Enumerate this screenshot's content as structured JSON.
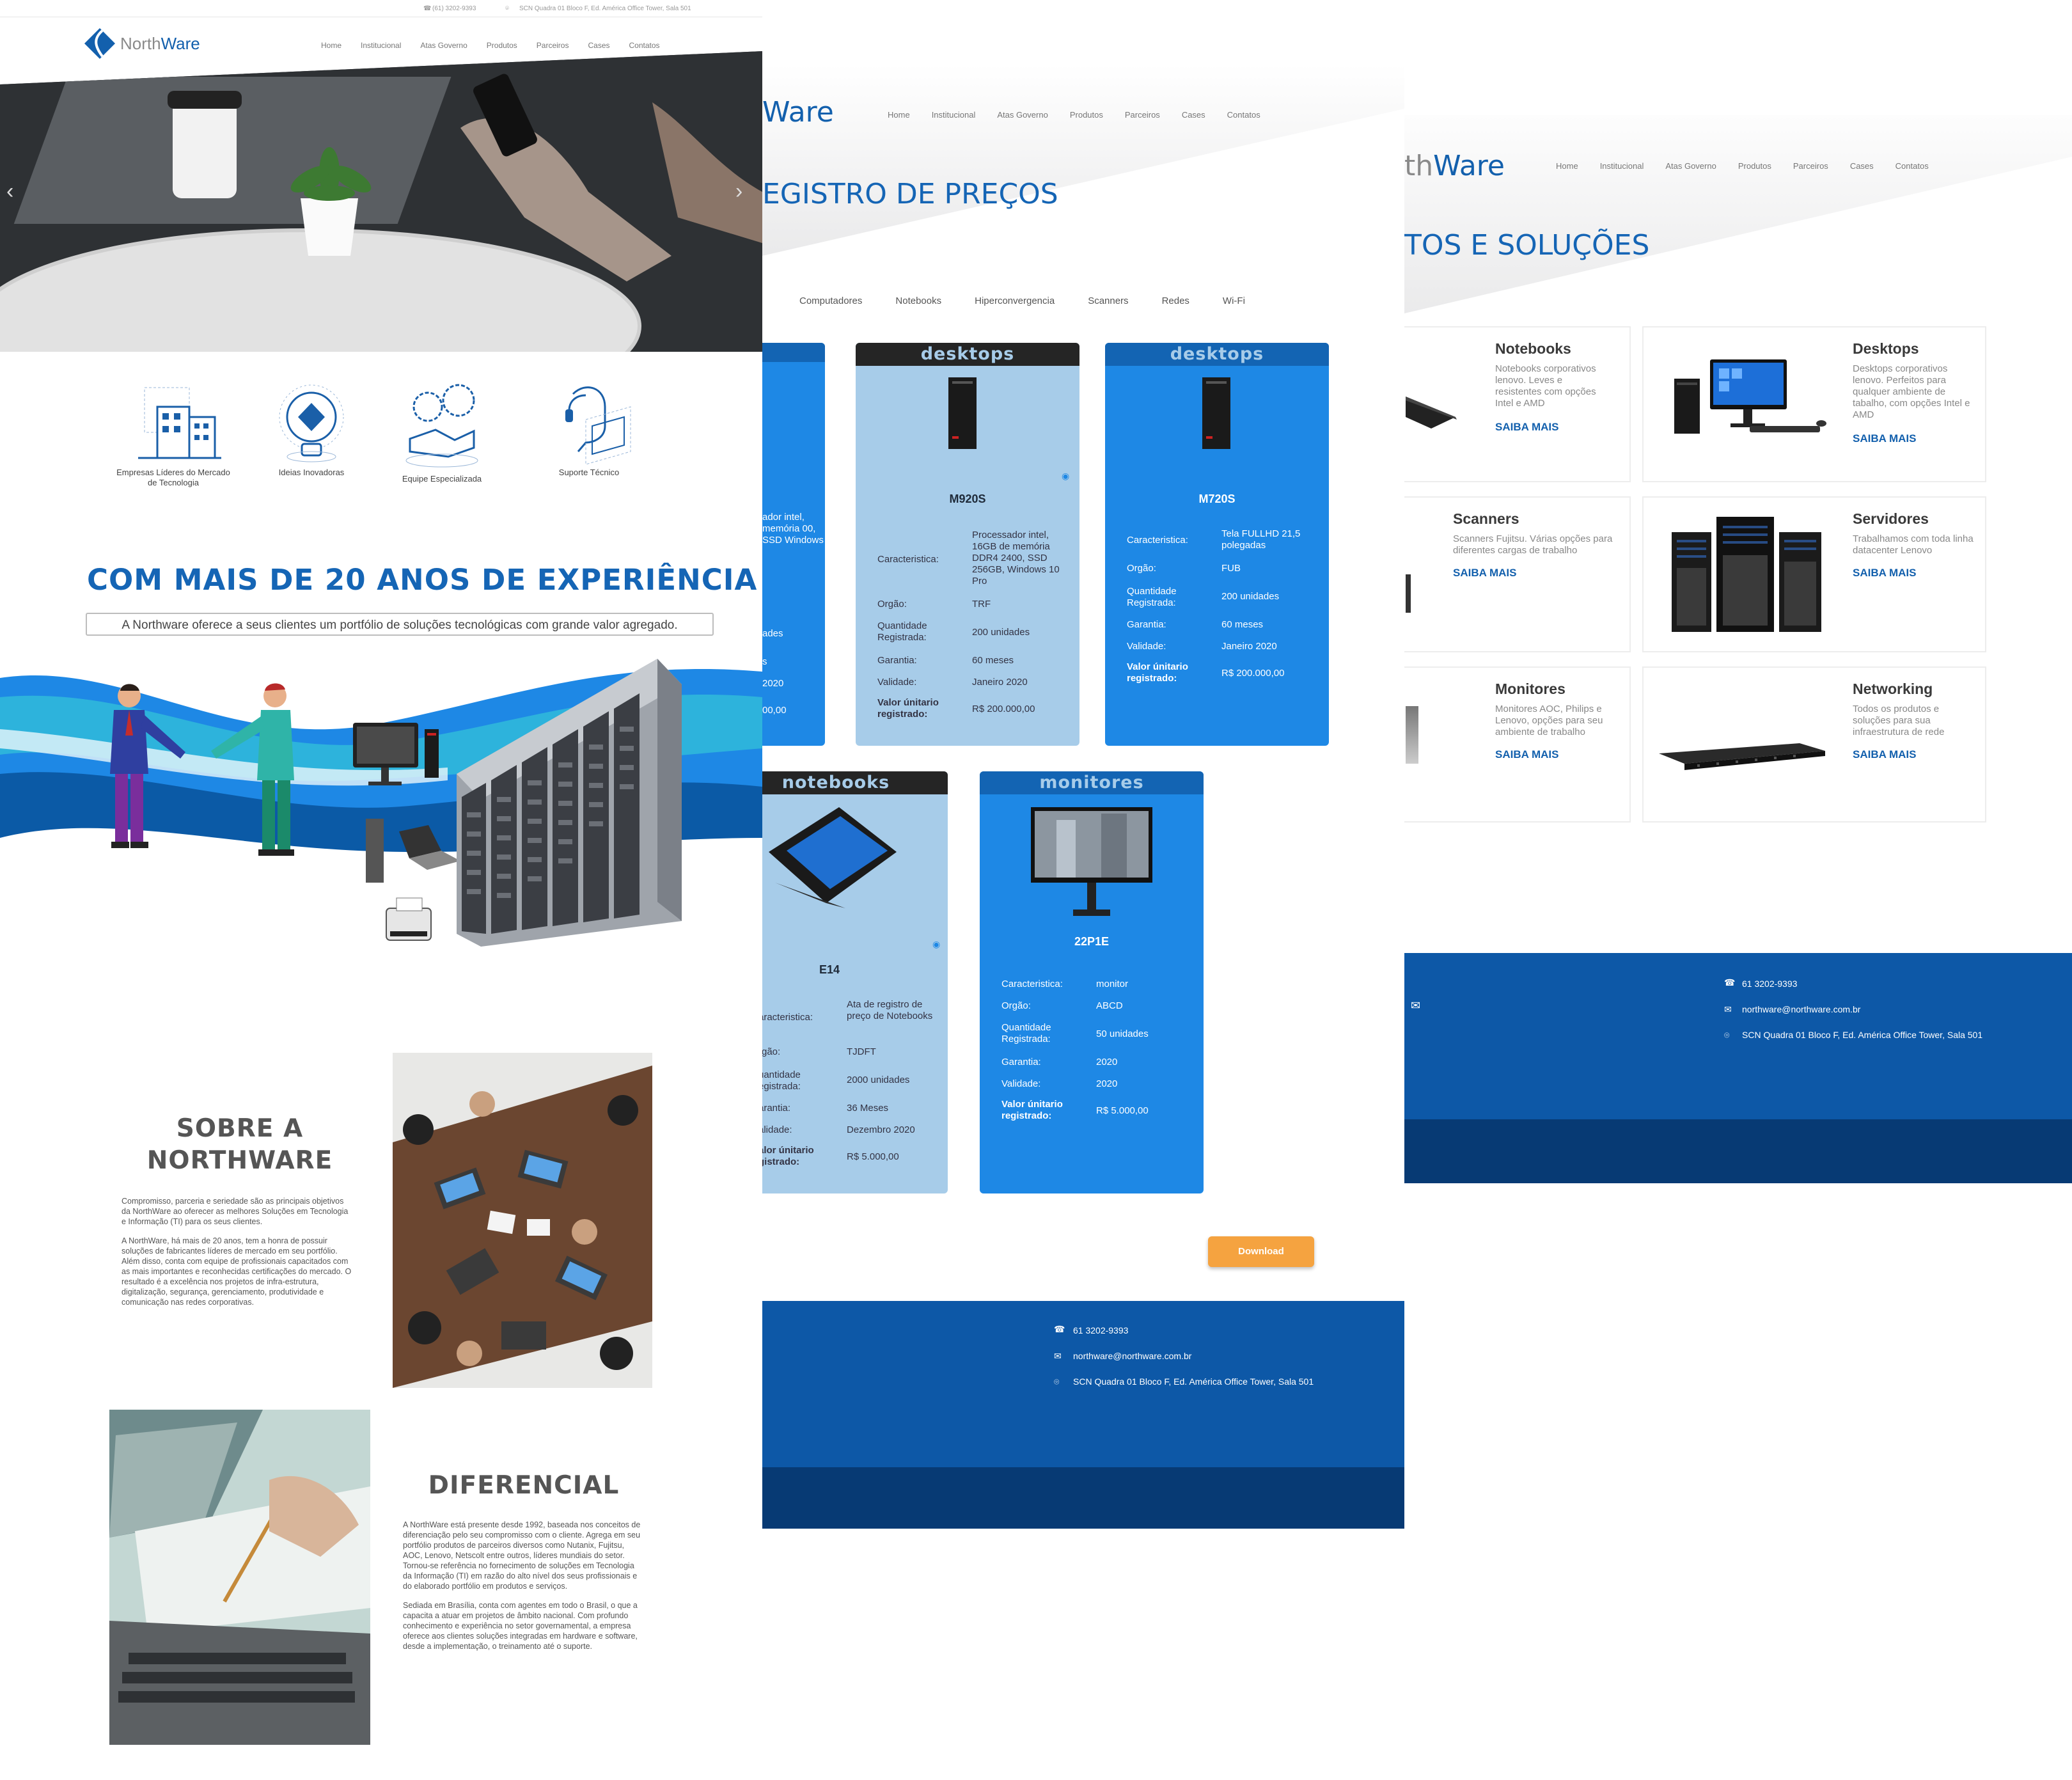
{
  "brand": {
    "logo_text_1": "North",
    "logo_text_2": "Ware"
  },
  "topbar": {
    "phone": "(61) 3202-9393",
    "address": "SCN Quadra 01 Bloco F, Ed. América Office Tower, Sala 501"
  },
  "nav": [
    "Home",
    "Institucional",
    "Atas Governo",
    "Produtos",
    "Parceiros",
    "Cases",
    "Contatos"
  ],
  "home": {
    "slider": {
      "prev": "‹",
      "next": "›"
    },
    "features": [
      {
        "label": "Empresas Líderes do Mercado de Tecnologia"
      },
      {
        "label": "Ideias Inovadoras"
      },
      {
        "label": "Equipe Especializada"
      },
      {
        "label": "Suporte Técnico"
      }
    ],
    "experience_title": "COM MAIS DE 20 ANOS DE EXPERIÊNCIA",
    "experience_sub": "A Northware oferece a seus clientes um portfólio de soluções tecnológicas com grande valor agregado.",
    "about_title_1": "SOBRE A",
    "about_title_2": "NORTHWARE",
    "about_p1": "Compromisso, parceria e seriedade são as principais objetivos da NorthWare ao oferecer as melhores Soluções em Tecnologia e Informação (TI) para os seus clientes.",
    "about_p2": "A NorthWare, há mais de 20 anos, tem a honra de possuir soluções de fabricantes líderes de mercado em seu portfólio. Além disso, conta com equipe de profissionais capacitados com as mais importantes e reconhecidas certificações do mercado. O resultado é a excelência nos projetos de infra-estrutura, digitalização, segurança, gerenciamento, produtividade e comunicação nas redes corporativas.",
    "diff_title": "DIFERENCIAL",
    "diff_p1": "A NorthWare está presente desde 1992, baseada nos conceitos de diferenciação pelo seu compromisso com o cliente. Agrega em seu portfólio produtos de parceiros diversos como Nutanix, Fujitsu, AOC, Lenovo, Netscolt entre outros, líderes mundiais do setor. Tornou-se referência no fornecimento de soluções em Tecnologia da Informação (TI) em razão do alto nível dos seus profissionais e do elaborado portfólio em produtos e serviços.",
    "diff_p2": "Sediada em Brasília, conta com agentes em todo o Brasil, o que a capacita a atuar em projetos de âmbito nacional. Com profundo conhecimento e experiência no setor governamental, a empresa oferece aos clientes soluções integradas em hardware e software, desde a implementação, o treinamento até o suporte."
  },
  "atas": {
    "logo_partial": "Ware",
    "title": "EGISTRO DE PREÇOS",
    "filters": [
      "Computadores",
      "Notebooks",
      "Hiperconvergencia",
      "Scanners",
      "Redes",
      "Wi-Fi"
    ],
    "labels": {
      "caracteristica": "Caracteristica:",
      "orgao": "Orgão:",
      "quantidade": "Quantidade Registrada:",
      "garantia": "Garantia:",
      "validade": "Validade:",
      "valor": "Valor únitario registrado:"
    },
    "cut_card": {
      "caracteristica": "ador intel, memória 00, SSD Windows",
      "quantidade": "ades",
      "garantia": "s",
      "validade": "2020",
      "valor": "00,00"
    },
    "cards": [
      {
        "category": "desktops",
        "name": "M920S",
        "caracteristica": "Processador intel, 16GB de memória DDR4 2400, SSD 256GB, Windows 10 Pro",
        "orgao": "TRF",
        "quantidade": "200 unidades",
        "garantia": "60 meses",
        "validade": "Janeiro 2020",
        "valor": "R$ 200.000,00"
      },
      {
        "category": "desktops",
        "name": "M720S",
        "caracteristica": "Tela FULLHD 21,5 polegadas",
        "orgao": "FUB",
        "quantidade": "200 unidades",
        "garantia": "60 meses",
        "validade": "Janeiro 2020",
        "valor": "R$ 200.000,00"
      },
      {
        "category": "notebooks",
        "name": "E14",
        "caracteristica": "Ata de registro de preço de Notebooks",
        "orgao": "TJDFT",
        "quantidade": "2000 unidades",
        "garantia": "36 Meses",
        "validade": "Dezembro 2020",
        "valor": "R$ 5.000,00"
      },
      {
        "category": "monitores",
        "name": "22P1E",
        "caracteristica": "monitor",
        "orgao": "ABCD",
        "quantidade": "50 unidades",
        "garantia": "2020",
        "validade": "2020",
        "valor": "R$ 5.000,00"
      }
    ],
    "cut_labels": {
      "caracteristica": "aracteristica:",
      "orgao": "rgão:",
      "quantidade": "uantidade egistrada:",
      "garantia": "arantia:",
      "validade": "alidade:",
      "valor": "alor únitario gistrado:"
    },
    "download": "Download"
  },
  "footer": {
    "phone": "61 3202-9393",
    "email": "northware@northware.com.br",
    "address": "SCN Quadra 01 Bloco F, Ed. América Office Tower, Sala 501"
  },
  "produtos": {
    "logo_partial": "thWare",
    "title": "TOS E SOLUÇÕES",
    "saiba": "SAIBA MAIS",
    "tiles": [
      {
        "title": "Notebooks",
        "desc": "Notebooks corporativos lenovo. Leves e resistentes com opções Intel e AMD"
      },
      {
        "title": "Desktops",
        "desc": "Desktops corporativos lenovo. Perfeitos para qualquer ambiente de tabalho, com opções Intel e AMD"
      },
      {
        "title": "Scanners",
        "desc": "Scanners Fujitsu. Várias opções para diferentes cargas de trabalho"
      },
      {
        "title": "Servidores",
        "desc": "Trabalhamos com toda linha datacenter Lenovo"
      },
      {
        "title": "Monitores",
        "desc": "Monitores AOC, Philips e Lenovo, opções para seu ambiente de trabalho"
      },
      {
        "title": "Networking",
        "desc": "Todos os produtos e soluções para sua infraestrutura de rede"
      }
    ]
  },
  "colors": {
    "brand_blue": "#1360ad",
    "title_blue": "#1565b5",
    "card_light": "#a7cce9",
    "card_blue": "#1e88e5",
    "footer_blue": "#0d58a7",
    "download_orange": "#f5a340"
  }
}
